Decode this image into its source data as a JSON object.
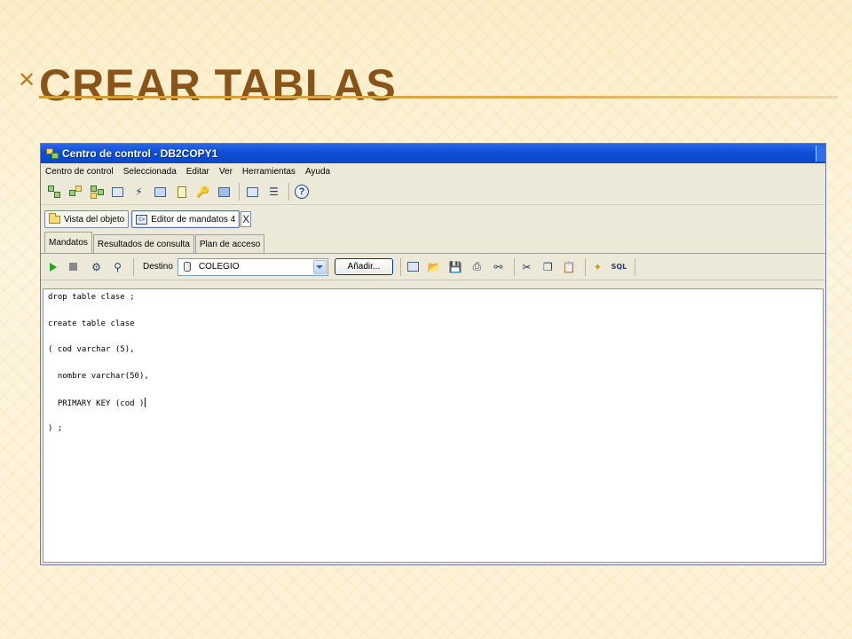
{
  "slide": {
    "title": "Crear tablas"
  },
  "window": {
    "title": "Centro de control - DB2COPY1"
  },
  "menu": [
    "Centro de control",
    "Seleccionada",
    "Editar",
    "Ver",
    "Herramientas",
    "Ayuda"
  ],
  "toolbar": {
    "icons": [
      "object-tree-icon",
      "add-object-icon",
      "network-icon",
      "command-editor-icon",
      "replication-icon",
      "task-center-icon",
      "journal-icon",
      "license-icon",
      "monitor-icon",
      "settings-icon",
      "list-icon",
      "help-icon"
    ],
    "help_label": "?"
  },
  "doc_tabs": [
    {
      "label": "Vista del objeto"
    },
    {
      "label": "Editor de mandatos 4"
    }
  ],
  "close_label": "X",
  "sub_tabs": [
    {
      "label": "Mandatos"
    },
    {
      "label": "Resultados de consulta"
    },
    {
      "label": "Plan de acceso"
    }
  ],
  "editor_toolbar": {
    "destino_label": "Destino",
    "target_value": "COLEGIO",
    "add_button": "Añadir...",
    "icons": [
      "run-icon",
      "stop-icon",
      "explain-icon",
      "access-plan-icon",
      "command-icon",
      "open-icon",
      "save-icon",
      "print-icon",
      "find-icon",
      "cut-icon",
      "copy-icon",
      "paste-icon",
      "options-icon",
      "sql-assist-icon"
    ]
  },
  "editor": {
    "lines": [
      "drop table clase ;",
      "create table clase",
      "( cod varchar (5),",
      "  nombre varchar(50),",
      "  PRIMARY KEY (cod )",
      ") ;"
    ]
  },
  "colors": {
    "title": "#8a5418",
    "titlebar": "#0d4fd6",
    "rule": "#d79a34"
  }
}
